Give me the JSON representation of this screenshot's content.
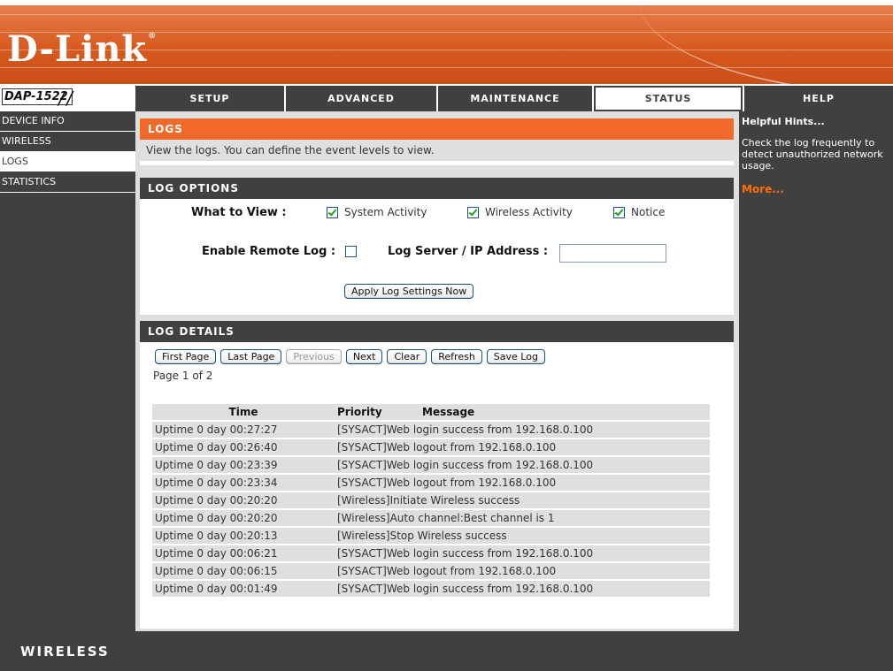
{
  "brand": {
    "logo": "D-Link",
    "model": "DAP-1522",
    "footer": "WIRELESS"
  },
  "tabs": [
    {
      "label": "SETUP"
    },
    {
      "label": "ADVANCED"
    },
    {
      "label": "MAINTENANCE"
    },
    {
      "label": "STATUS"
    },
    {
      "label": "HELP"
    }
  ],
  "sidebar": {
    "items": [
      {
        "label": "DEVICE INFO"
      },
      {
        "label": "WIRELESS"
      },
      {
        "label": "LOGS"
      },
      {
        "label": "STATISTICS"
      }
    ]
  },
  "hints": {
    "title": "Helpful Hints...",
    "text": "Check the log frequently to detect unauthorized network usage.",
    "more": "More..."
  },
  "logs": {
    "title": "LOGS",
    "description": "View the logs. You can define the event levels to view."
  },
  "options": {
    "title": "LOG OPTIONS",
    "what_to_view": "What to View :",
    "system_activity": "System Activity",
    "wireless_activity": "Wireless Activity",
    "notice": "Notice",
    "enable_remote": "Enable Remote Log :",
    "log_server": "Log Server / IP Address :",
    "log_server_value": "",
    "apply": "Apply Log Settings Now",
    "system_checked": true,
    "wireless_checked": true,
    "notice_checked": true,
    "remote_checked": false
  },
  "details": {
    "title": "LOG DETAILS",
    "buttons": {
      "first": "First Page",
      "last": "Last Page",
      "previous": "Previous",
      "next": "Next",
      "clear": "Clear",
      "refresh": "Refresh",
      "save": "Save Log"
    },
    "page_info": "Page 1 of 2",
    "columns": {
      "time": "Time",
      "priority": "Priority",
      "message": "Message"
    },
    "rows": [
      {
        "time": "Uptime 0 day 00:27:27",
        "message": "[SYSACT]Web login success from 192.168.0.100"
      },
      {
        "time": "Uptime 0 day 00:26:40",
        "message": "[SYSACT]Web logout from 192.168.0.100"
      },
      {
        "time": "Uptime 0 day 00:23:39",
        "message": "[SYSACT]Web login success from 192.168.0.100"
      },
      {
        "time": "Uptime 0 day 00:23:34",
        "message": "[SYSACT]Web logout from 192.168.0.100"
      },
      {
        "time": "Uptime 0 day 00:20:20",
        "message": "[Wireless]Initiate Wireless success"
      },
      {
        "time": "Uptime 0 day 00:20:20",
        "message": "[Wireless]Auto channel:Best channel is 1"
      },
      {
        "time": "Uptime 0 day 00:20:13",
        "message": "[Wireless]Stop Wireless success"
      },
      {
        "time": "Uptime 0 day 00:06:21",
        "message": "[SYSACT]Web login success from 192.168.0.100"
      },
      {
        "time": "Uptime 0 day 00:06:15",
        "message": "[SYSACT]Web logout from 192.168.0.100"
      },
      {
        "time": "Uptime 0 day 00:01:49",
        "message": "[SYSACT]Web login success from 192.168.0.100"
      }
    ]
  }
}
